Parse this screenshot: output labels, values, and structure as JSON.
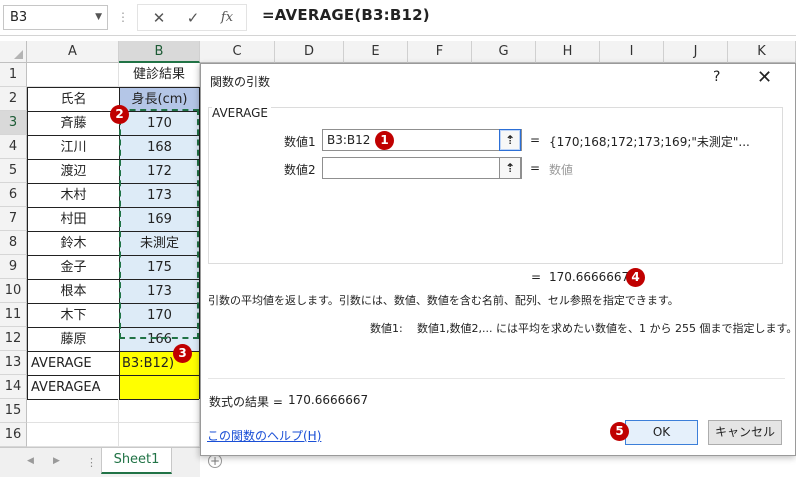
{
  "formula_bar": {
    "name_box": "B3",
    "cancel_icon": "✕",
    "enter_icon": "✓",
    "fx_icon": "fx",
    "formula": "=AVERAGE(B3:B12)"
  },
  "columns": [
    "A",
    "B",
    "C",
    "D",
    "E",
    "F",
    "G",
    "H",
    "I",
    "J",
    "K"
  ],
  "rows": [
    "1",
    "2",
    "3",
    "4",
    "5",
    "6",
    "7",
    "8",
    "9",
    "10",
    "11",
    "12",
    "13",
    "14",
    "15",
    "16"
  ],
  "cells": {
    "b1": "健診結果",
    "a2": "氏名",
    "b2": "身長(cm)",
    "names": [
      "斉藤",
      "江川",
      "渡辺",
      "木村",
      "村田",
      "鈴木",
      "金子",
      "根本",
      "木下",
      "藤原"
    ],
    "heights": [
      "170",
      "168",
      "172",
      "173",
      "169",
      "未測定",
      "175",
      "173",
      "170",
      "166"
    ],
    "a13": "AVERAGE",
    "b13": "B3:B12)",
    "a14": "AVERAGEA"
  },
  "dialog": {
    "title": "関数の引数",
    "help": "?",
    "close": "✕",
    "function_name": "AVERAGE",
    "arg1_label": "数値1",
    "arg1_value": "B3:B12",
    "arg1_result": "{170;168;172;173;169;\"未測定\"...",
    "arg2_label": "数値2",
    "arg2_value": "",
    "arg2_result": "数値",
    "equals": "=",
    "ref_icon": "⇡",
    "result": "170.6666667",
    "description": "引数の平均値を返します。引数には、数値、数値を含む名前、配列、セル参照を指定できます。",
    "arg_desc_label": "数値1:",
    "arg_desc": "数値1,数値2,... には平均を求めたい数値を、1 から 255 個まで指定します。",
    "formula_result_label": "数式の結果 =",
    "formula_result": "170.6666667",
    "help_link": "この関数のヘルプ(H)",
    "ok": "OK",
    "cancel": "キャンセル"
  },
  "badges": [
    "1",
    "2",
    "3",
    "4",
    "5"
  ],
  "sheet_tabs": {
    "active": "Sheet1",
    "add": "+"
  },
  "colors": {
    "header_fill": "#b4c6e7",
    "data_fill": "#ddebf7",
    "highlight": "#ffff00",
    "accent": "#217346",
    "badge": "#c00000"
  }
}
